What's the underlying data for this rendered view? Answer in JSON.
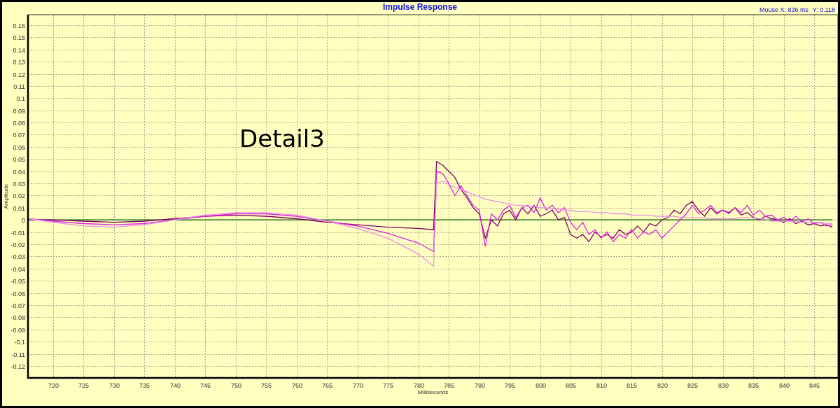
{
  "readout": {
    "x": "Mouse X: 836 ms",
    "y": "Y: 0.118"
  },
  "chart": {
    "chart_data": {
      "type": "line",
      "title": "Impulse Response",
      "xlabel": "Milliseconds",
      "ylabel": "Amplitude",
      "x": [
        716,
        720,
        725,
        730,
        735,
        740,
        745,
        750,
        755,
        760,
        765,
        770,
        775,
        780,
        782.5,
        783,
        784,
        785,
        786,
        787,
        788,
        789,
        790,
        791,
        792,
        793,
        794,
        795,
        796,
        797,
        798,
        799,
        800,
        801,
        802,
        803,
        804,
        805,
        806,
        807,
        808,
        809,
        810,
        811,
        812,
        813,
        814,
        815,
        816,
        817,
        818,
        819,
        820,
        821,
        822,
        823,
        824,
        825,
        826,
        827,
        828,
        829,
        830,
        831,
        832,
        833,
        834,
        835,
        836,
        837,
        838,
        839,
        840,
        841,
        842,
        843,
        844,
        845,
        846,
        847,
        848
      ],
      "series": [
        {
          "color": "#006000",
          "values": [
            0,
            0,
            0,
            0,
            0,
            0,
            0,
            0,
            0,
            0,
            0,
            0,
            0,
            0,
            0,
            0,
            0,
            0,
            0,
            0,
            0,
            0,
            0,
            0,
            0,
            0,
            0,
            0,
            0,
            0,
            0,
            0,
            0,
            0,
            0,
            0,
            0,
            0,
            0,
            0,
            0,
            0,
            0,
            0,
            0,
            0,
            0,
            0,
            0,
            0,
            0,
            0,
            0,
            0,
            0,
            0,
            0,
            0,
            0,
            0,
            0,
            0,
            0,
            0,
            0,
            0,
            0,
            0,
            0,
            0,
            0,
            0,
            0,
            0,
            0,
            0,
            0,
            0,
            0,
            0,
            0
          ]
        },
        {
          "color": "#800060",
          "values": [
            0,
            0,
            -0.001,
            -0.002,
            -0.001,
            0.001,
            0.003,
            0.004,
            0.003,
            0.001,
            -0.002,
            -0.004,
            -0.006,
            -0.007,
            -0.008,
            0.048,
            0.045,
            0.04,
            0.035,
            0.025,
            0.018,
            0.01,
            0.005,
            -0.015,
            0,
            -0.005,
            0.005,
            0.008,
            0,
            0.01,
            0.005,
            0.012,
            0.003,
            0.005,
            0.008,
            0,
            0.002,
            -0.012,
            -0.015,
            -0.012,
            -0.018,
            -0.01,
            -0.014,
            -0.012,
            -0.015,
            -0.008,
            -0.012,
            -0.01,
            -0.005,
            -0.01,
            -0.003,
            -0.005,
            0,
            0.002,
            0.008,
            0.005,
            0.012,
            0.015,
            0.008,
            0.003,
            0.01,
            0.005,
            0.008,
            0.006,
            0.01,
            0.004,
            0.006,
            0.002,
            0,
            0.003,
            0.001,
            0,
            -0.002,
            0.001,
            -0.003,
            -0.001,
            -0.004,
            -0.003,
            -0.005,
            -0.004,
            -0.006
          ]
        },
        {
          "color": "#e020e0",
          "values": [
            0.001,
            -0.001,
            -0.003,
            -0.004,
            -0.003,
            0,
            0.003,
            0.005,
            0.005,
            0.003,
            -0.001,
            -0.005,
            -0.011,
            -0.019,
            -0.026,
            0.04,
            0.038,
            0.03,
            0.02,
            0.028,
            0.02,
            0.012,
            0.008,
            -0.022,
            0.005,
            0,
            0.008,
            0.012,
            0.002,
            0.01,
            0.012,
            0.006,
            0.018,
            0.008,
            0.012,
            0.006,
            0.01,
            -0.002,
            -0.008,
            -0.002,
            -0.012,
            -0.008,
            -0.015,
            -0.01,
            -0.018,
            -0.012,
            -0.015,
            -0.008,
            -0.015,
            -0.01,
            -0.012,
            -0.008,
            -0.015,
            -0.01,
            -0.005,
            0,
            0.005,
            0.012,
            0.005,
            0.008,
            0.012,
            0.006,
            0.008,
            0.005,
            0.01,
            0.006,
            0.012,
            0.004,
            0.008,
            0.003,
            0.004,
            0,
            0.002,
            -0.001,
            0.003,
            -0.002,
            0.001,
            -0.003,
            -0.002,
            -0.005,
            -0.004
          ]
        },
        {
          "color": "#e890e8",
          "values": [
            0.001,
            -0.002,
            -0.005,
            -0.006,
            -0.004,
            0,
            0.004,
            0.006,
            0.006,
            0.004,
            -0.001,
            -0.007,
            -0.015,
            -0.028,
            -0.038,
            0.03,
            0.032,
            0.029,
            0.027,
            0.025,
            0.023,
            0.021,
            0.019,
            0.017,
            0.016,
            0.015,
            0.014,
            0.013,
            0.012,
            0.012,
            0.011,
            0.011,
            0.01,
            0.01,
            0.009,
            0.009,
            0.008,
            0.008,
            0.007,
            0.007,
            0.007,
            0.006,
            0.006,
            0.006,
            0.005,
            0.005,
            0.005,
            0.004,
            0.004,
            0.004,
            0.004,
            0.003,
            0.003,
            0.003,
            0.003,
            0.002,
            0.002,
            0.002,
            0.002,
            0.002,
            0.001,
            0.001,
            0.001,
            0.001,
            0.001,
            0.002,
            0.002,
            0.0015,
            0.001,
            0.0005,
            -0.001,
            -0.001,
            -0.001,
            -0.001,
            -0.001,
            -0.002,
            -0.002,
            -0.002,
            -0.002,
            -0.003,
            -0.003
          ]
        }
      ],
      "xlim": [
        715.9,
        848.9
      ],
      "ylim": [
        -0.1298,
        0.1686
      ],
      "xticks": [
        720,
        725,
        730,
        735,
        740,
        745,
        750,
        755,
        760,
        765,
        770,
        775,
        780,
        785,
        790,
        795,
        800,
        805,
        810,
        815,
        820,
        825,
        830,
        835,
        840,
        845
      ],
      "yticks": [
        0.16,
        0.15,
        0.14,
        0.13,
        0.12,
        0.11,
        0.1,
        0.09,
        0.08,
        0.07,
        0.06,
        0.05,
        0.04,
        0.03,
        0.02,
        0.01,
        0,
        -0.01,
        -0.02,
        -0.03,
        -0.04,
        -0.05,
        -0.06,
        -0.07,
        -0.08,
        -0.09,
        -0.1,
        -0.11,
        -0.12
      ],
      "grid": true,
      "annotations": [
        "Detail3"
      ]
    }
  }
}
